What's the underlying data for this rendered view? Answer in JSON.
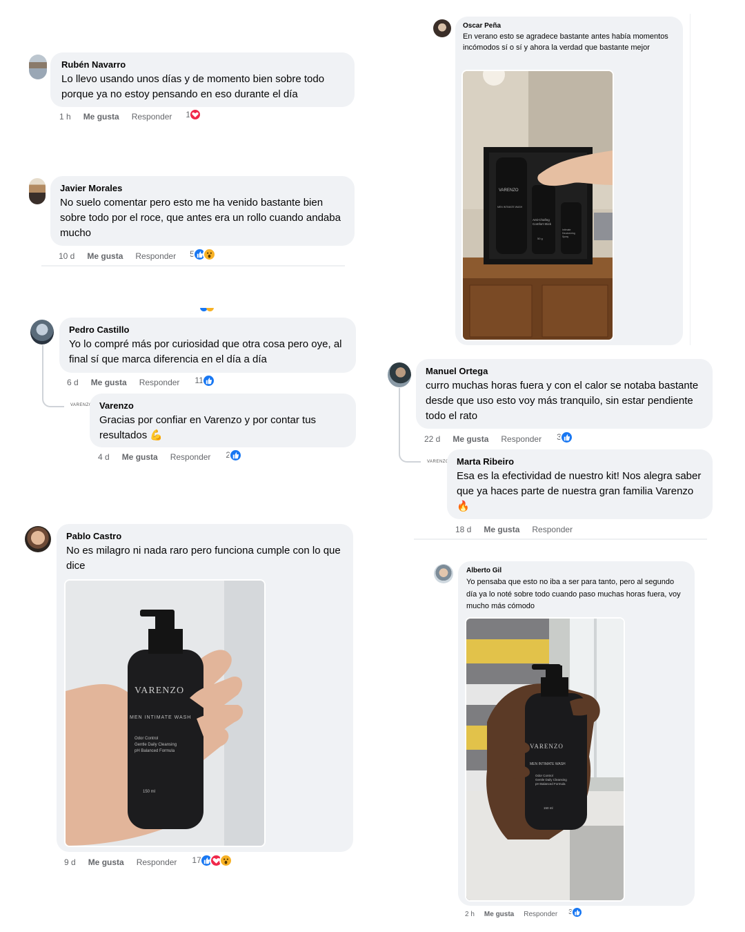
{
  "colors": {
    "bubble": "#f0f2f5",
    "meta": "#65676b",
    "like_blue": "#1877f2",
    "love_red": "#f0284a",
    "wow_yellow": "#f7b125"
  },
  "comments": {
    "ruben": {
      "name": "Rubén Navarro",
      "text": "Lo llevo usando unos días y de momento bien sobre todo porque ya no estoy pensando en eso durante el día",
      "time": "1 h",
      "like": "Me gusta",
      "reply": "Responder",
      "count": "1",
      "reactions": [
        "love"
      ]
    },
    "javier": {
      "name": "Javier Morales",
      "text": "No suelo comentar pero esto me ha venido bastante bien sobre todo por el roce, que antes era un rollo cuando andaba mucho",
      "time": "10 d",
      "like": "Me gusta",
      "reply": "Responder",
      "count": "5",
      "reactions": [
        "like",
        "wow"
      ]
    },
    "pedro": {
      "name": "Pedro Castillo",
      "text": "Yo lo compré más por curiosidad que otra cosa pero oye, al final sí que marca diferencia en el día a día",
      "time": "6 d",
      "like": "Me gusta",
      "reply": "Responder",
      "count": "11",
      "reactions": [
        "like"
      ]
    },
    "varenzo_reply": {
      "name": "Varenzo",
      "text": "Gracias por confiar en Varenzo y por contar tus resultados 💪",
      "time": "4 d",
      "like": "Me gusta",
      "reply": "Responder",
      "count": "2",
      "reactions": [
        "like"
      ],
      "avatar_logo": "VARENZO"
    },
    "pablo": {
      "name": "Pablo Castro",
      "text": "No es milagro ni nada raro pero funciona cumple con lo que dice",
      "time": "9 d",
      "like": "Me gusta",
      "reply": "Responder",
      "count": "17",
      "reactions": [
        "like",
        "love",
        "wow"
      ]
    },
    "oscar": {
      "name": "Oscar Peña",
      "text": "En verano esto se agradece bastante antes había momentos incómodos sí o sí y ahora la verdad que bastante mejor"
    },
    "manuel": {
      "name": "Manuel Ortega",
      "text": "curro muchas horas fuera y con el calor se notaba bastante desde que uso esto voy más tranquilo, sin estar pendiente todo el rato",
      "time": "22 d",
      "like": "Me gusta",
      "reply": "Responder",
      "count": "3",
      "reactions": [
        "like"
      ]
    },
    "marta": {
      "name": "Marta Ribeiro",
      "text": "Esa es la efectividad de nuestro kit! Nos alegra saber que ya haces parte de nuestra gran familia Varenzo 🔥",
      "time": "18 d",
      "like": "Me gusta",
      "reply": "Responder",
      "avatar_logo": "VARENZO"
    },
    "alberto": {
      "name": "Alberto Gil",
      "text": "Yo pensaba que esto no iba a ser para tanto, pero al segundo día ya lo noté sobre todo cuando paso muchas horas fuera, voy mucho más cómodo",
      "time": "2 h",
      "like": "Me gusta",
      "reply": "Responder",
      "count": "3",
      "reactions": [
        "like"
      ]
    }
  },
  "product": {
    "brand": "VARENZO",
    "wash_name": "MEN INTIMATE WASH",
    "wash_features": "Odor Control\nGentle Daily Cleansing\npH Balanced Formula",
    "wash_volume": "150 ml",
    "stick_name": "Anti-Chafing Comfort Stick",
    "stick_weight": "50 g",
    "spray_name": "Intimate Deodorizing Spray"
  }
}
